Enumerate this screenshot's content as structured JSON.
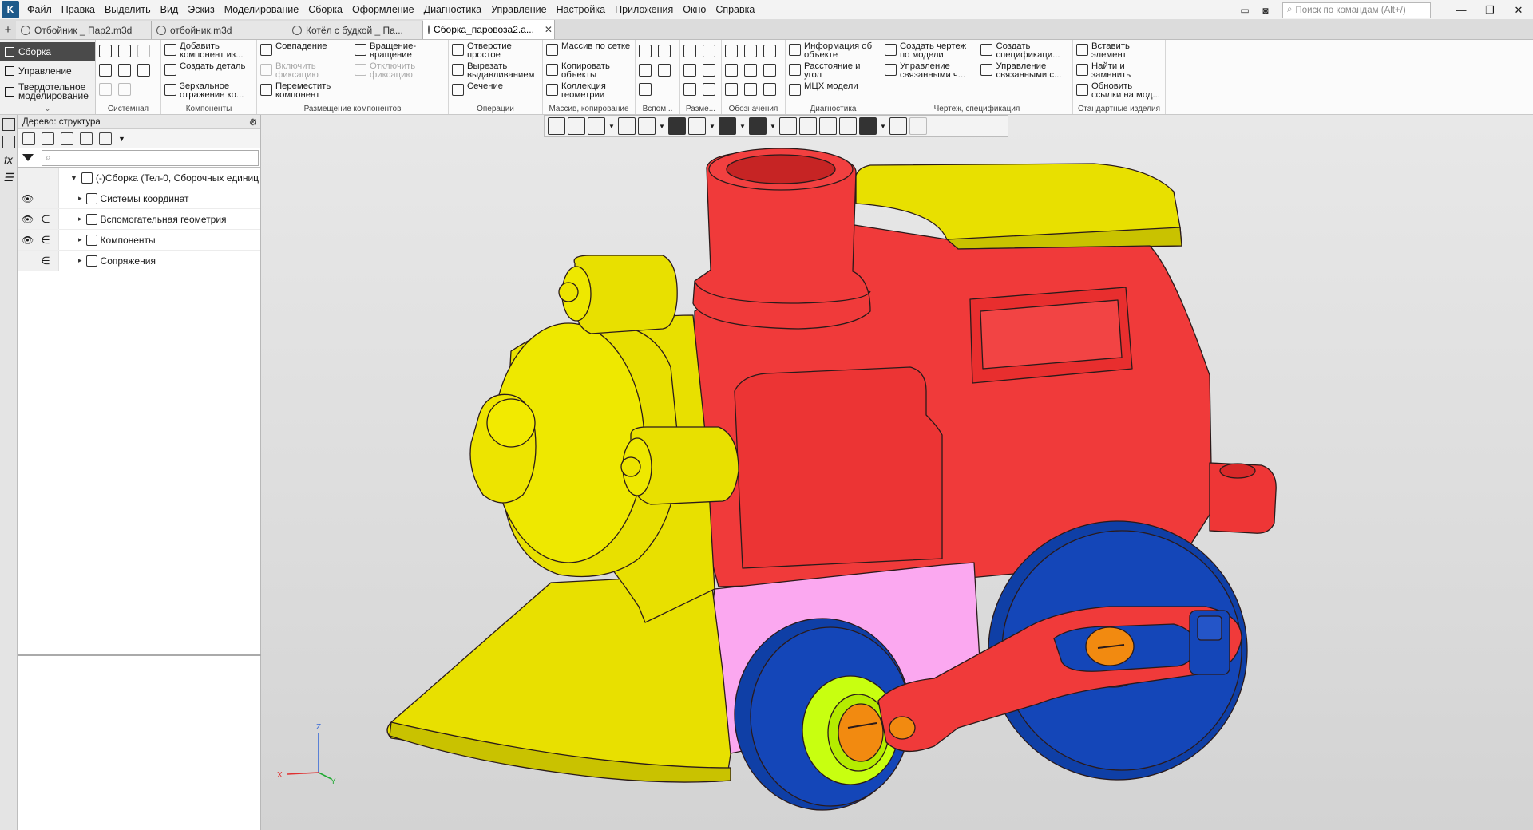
{
  "app": {
    "logo_glyph": "K"
  },
  "menu": [
    "Файл",
    "Правка",
    "Выделить",
    "Вид",
    "Эскиз",
    "Моделирование",
    "Сборка",
    "Оформление",
    "Диагностика",
    "Управление",
    "Настройка",
    "Приложения",
    "Окно",
    "Справка"
  ],
  "search": {
    "placeholder": "Поиск по командам (Alt+/)"
  },
  "tabs": [
    {
      "label": "Отбойник _ Пар2.m3d",
      "active": false
    },
    {
      "label": "отбойник.m3d",
      "active": false
    },
    {
      "label": "Котёл с будкой _ Па...",
      "active": false
    },
    {
      "label": "Сборка_паровоза2.a...",
      "active": true
    }
  ],
  "ribbon_tabs": [
    {
      "label": "Сборка",
      "active": true
    },
    {
      "label": "Управление",
      "active": false
    },
    {
      "label": "Твердотельное моделирование",
      "active": false
    }
  ],
  "groups": {
    "system": "Системная",
    "components": "Компоненты",
    "placement": "Размещение компонентов",
    "operations": "Операции",
    "array_copy": "Массив, копирование",
    "aux": "Вспом...",
    "dims": "Разме...",
    "designations": "Обозначения",
    "diagnostics": "Диагностика",
    "drawing_spec": "Чертеж, спецификация",
    "standard": "Стандартные изделия"
  },
  "buttons": {
    "add_component": "Добавить компонент из...",
    "create_part": "Создать деталь",
    "mirror": "Зеркальное отражение ко...",
    "coincidence": "Совпадение",
    "rotation": "Вращение-вращение",
    "enable_fix": "Включить фиксацию",
    "disable_fix": "Отключить фиксацию",
    "move_component": "Переместить компонент",
    "hole": "Отверстие простое",
    "extrude_cut": "Вырезать выдавливанием",
    "section": "Сечение",
    "grid_array": "Массив по сетке",
    "copy_objects": "Копировать объекты",
    "geom_collection": "Коллекция геометрии",
    "object_info": "Информация об объекте",
    "distance_angle": "Расстояние и угол",
    "mass_props": "МЦХ модели",
    "create_drawing": "Создать чертеж по модели",
    "manage_linked": "Управление связанными ч...",
    "create_spec": "Создать спецификаци...",
    "manage_linked_c": "Управление связанными с...",
    "insert_element": "Вставить элемент",
    "find_replace": "Найти и заменить",
    "update_links": "Обновить ссылки на мод..."
  },
  "tree": {
    "title": "Дерево: структура",
    "filter_placeholder": "",
    "root": "(-)Сборка (Тел-0, Сборочных единиц",
    "items": [
      {
        "label": "Системы координат",
        "eye": true,
        "belong": false
      },
      {
        "label": "Вспомогательная геометрия",
        "eye": true,
        "belong": true
      },
      {
        "label": "Компоненты",
        "eye": true,
        "belong": true
      },
      {
        "label": "Сопряжения",
        "eye": false,
        "belong": true
      }
    ]
  },
  "axes": {
    "x": "X",
    "y": "Y",
    "z": "Z"
  },
  "colors": {
    "body": "#f03a3a",
    "yellow": "#e8e000",
    "wheel": "#1446b8",
    "pink": "#fba8f0",
    "orange": "#f28a10",
    "lime": "#c8ff10"
  }
}
